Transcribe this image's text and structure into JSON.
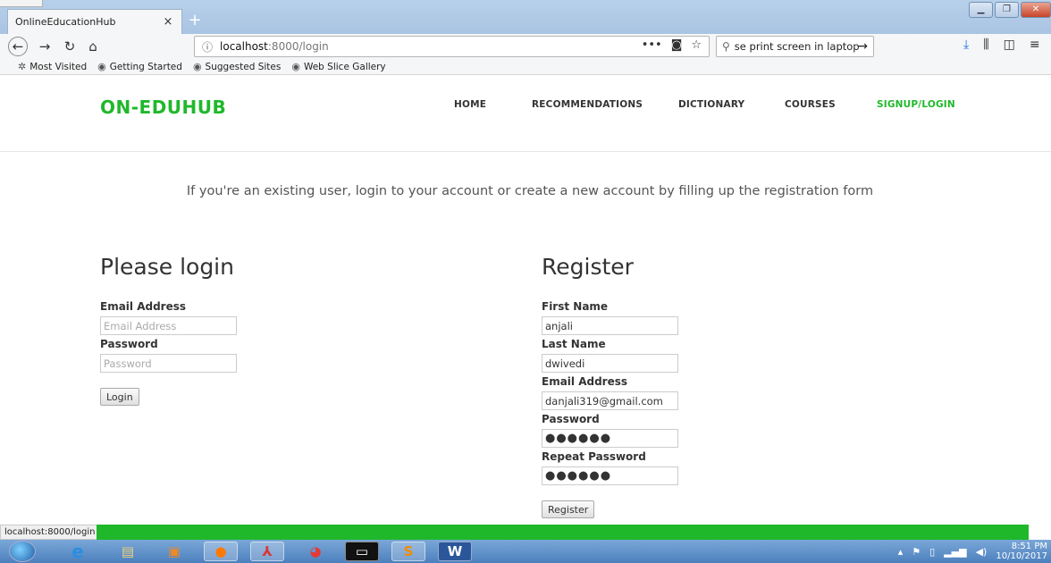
{
  "browser": {
    "tab_title": "OnlineEducationHub",
    "tab_close": "×",
    "new_tab": "+",
    "url_host": "localhost",
    "url_path": ":8000/login",
    "search_text": "se print screen in laptop",
    "bookmarks": [
      "Most Visited",
      "Getting Started",
      "Suggested Sites",
      "Web Slice Gallery"
    ],
    "status_url": "localhost:8000/login"
  },
  "site": {
    "logo": "ON-EDUHUB",
    "nav": [
      "HOME",
      "RECOMMENDATIONS",
      "DICTIONARY",
      "COURSES",
      "SIGNUP/LOGIN"
    ],
    "active_nav": "SIGNUP/LOGIN",
    "accent_color": "#1fb82b",
    "intro": "If you're an existing user, login to your account or create a new account by filling up the registration form"
  },
  "login": {
    "title": "Please login",
    "email_label": "Email Address",
    "email_placeholder": "Email Address",
    "password_label": "Password",
    "password_placeholder": "Password",
    "button": "Login"
  },
  "register": {
    "title": "Register",
    "first_name_label": "First Name",
    "first_name_value": "anjali",
    "last_name_label": "Last Name",
    "last_name_value": "dwivedi",
    "email_label": "Email Address",
    "email_value": "danjali319@gmail.com",
    "password_label": "Password",
    "password_value": "●●●●●●",
    "repeat_label": "Repeat Password",
    "repeat_value": "●●●●●●",
    "button": "Register"
  },
  "page_load_progress": 0.89,
  "taskbar": {
    "time": "8:51 PM",
    "date": "10/10/2017",
    "apps": [
      "internet-explorer",
      "file-explorer",
      "media-player",
      "firefox",
      "acrobat",
      "chrome",
      "command-prompt",
      "sublime-text",
      "word"
    ]
  }
}
